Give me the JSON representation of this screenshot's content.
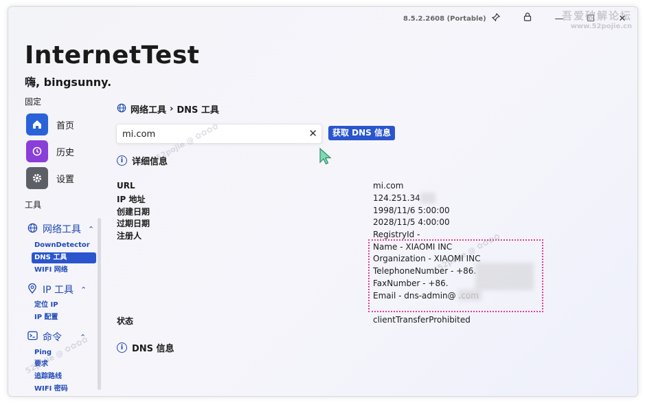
{
  "app": {
    "version": "8.5.2.2608 (Portable)",
    "title": "InternetTest",
    "greeting": "嗨, bingsunny.",
    "watermark_line1": "吾爱破解论坛",
    "watermark_line2": "www.52pojie.cn"
  },
  "titlebar": {
    "pin_icon": "pin-icon",
    "lock_icon": "lock-icon",
    "minimize_glyph": "—",
    "maximize_glyph": "☐",
    "close_glyph": "✕"
  },
  "sidebar": {
    "pinned_label": "固定",
    "pinned": [
      {
        "label": "首页",
        "icon": "home-icon",
        "color": "#2a62d9"
      },
      {
        "label": "历史",
        "icon": "history-icon",
        "color": "#8a3fd8"
      },
      {
        "label": "设置",
        "icon": "gear-icon",
        "color": "#5c5f66"
      }
    ],
    "tools_label": "工具",
    "groups": [
      {
        "label": "网络工具",
        "icon": "globe-icon",
        "items": [
          "DownDetector",
          "DNS 工具",
          "WIFI 网络"
        ]
      },
      {
        "label": "IP 工具",
        "icon": "location-icon",
        "items": [
          "定位 IP",
          "IP 配置"
        ]
      },
      {
        "label": "命令",
        "icon": "terminal-icon",
        "items": [
          "Ping",
          "要求",
          "追踪路线",
          "WIFI 密码"
        ]
      }
    ],
    "active_item": "DNS 工具"
  },
  "main": {
    "breadcrumb": {
      "parent": "网络工具",
      "separator": "›",
      "current": "DNS 工具"
    },
    "search": {
      "value": "mi.com",
      "clear_glyph": "✕"
    },
    "query_button": "获取 DNS 信息",
    "details_title": "详细信息",
    "details": [
      {
        "label": "URL",
        "value": "mi.com"
      },
      {
        "label": "IP 地址",
        "value": "124.251.34"
      },
      {
        "label": "创建日期",
        "value": "1998/11/6 5:00:00"
      },
      {
        "label": "过期日期",
        "value": "2028/11/5 4:00:00"
      },
      {
        "label": "注册人",
        "value": "RegistryId -"
      }
    ],
    "registrant": [
      "Name - XIAOMI INC",
      "Organization - XIAOMI INC",
      "TelephoneNumber - +86.",
      "FaxNumber - +86.",
      "Email - dns-admin@       .com"
    ],
    "status_label": "状态",
    "status_value": "clientTransferProhibited",
    "dns_title": "DNS 信息"
  },
  "colors": {
    "accent": "#2a55cc",
    "highlight_box": "#e23d8c"
  }
}
